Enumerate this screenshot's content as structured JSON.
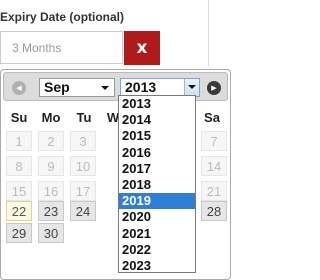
{
  "form": {
    "label": "Expiry Date (optional)",
    "value": "3 Months",
    "clear_label": "x"
  },
  "datepicker": {
    "month": "Sep",
    "year": "2013",
    "weekdays": [
      "Su",
      "Mo",
      "Tu",
      "W",
      "",
      "",
      "Sa"
    ],
    "days": [
      "1",
      "8",
      "15",
      "22",
      "29",
      "2",
      "9",
      "16",
      "23",
      "30",
      "3",
      "10",
      "17",
      "24",
      "7",
      "14",
      "21",
      "28"
    ],
    "year_options": [
      "2013",
      "2014",
      "2015",
      "2016",
      "2017",
      "2018",
      "2019",
      "2020",
      "2021",
      "2022",
      "2023"
    ],
    "highlighted_year": "2019"
  }
}
